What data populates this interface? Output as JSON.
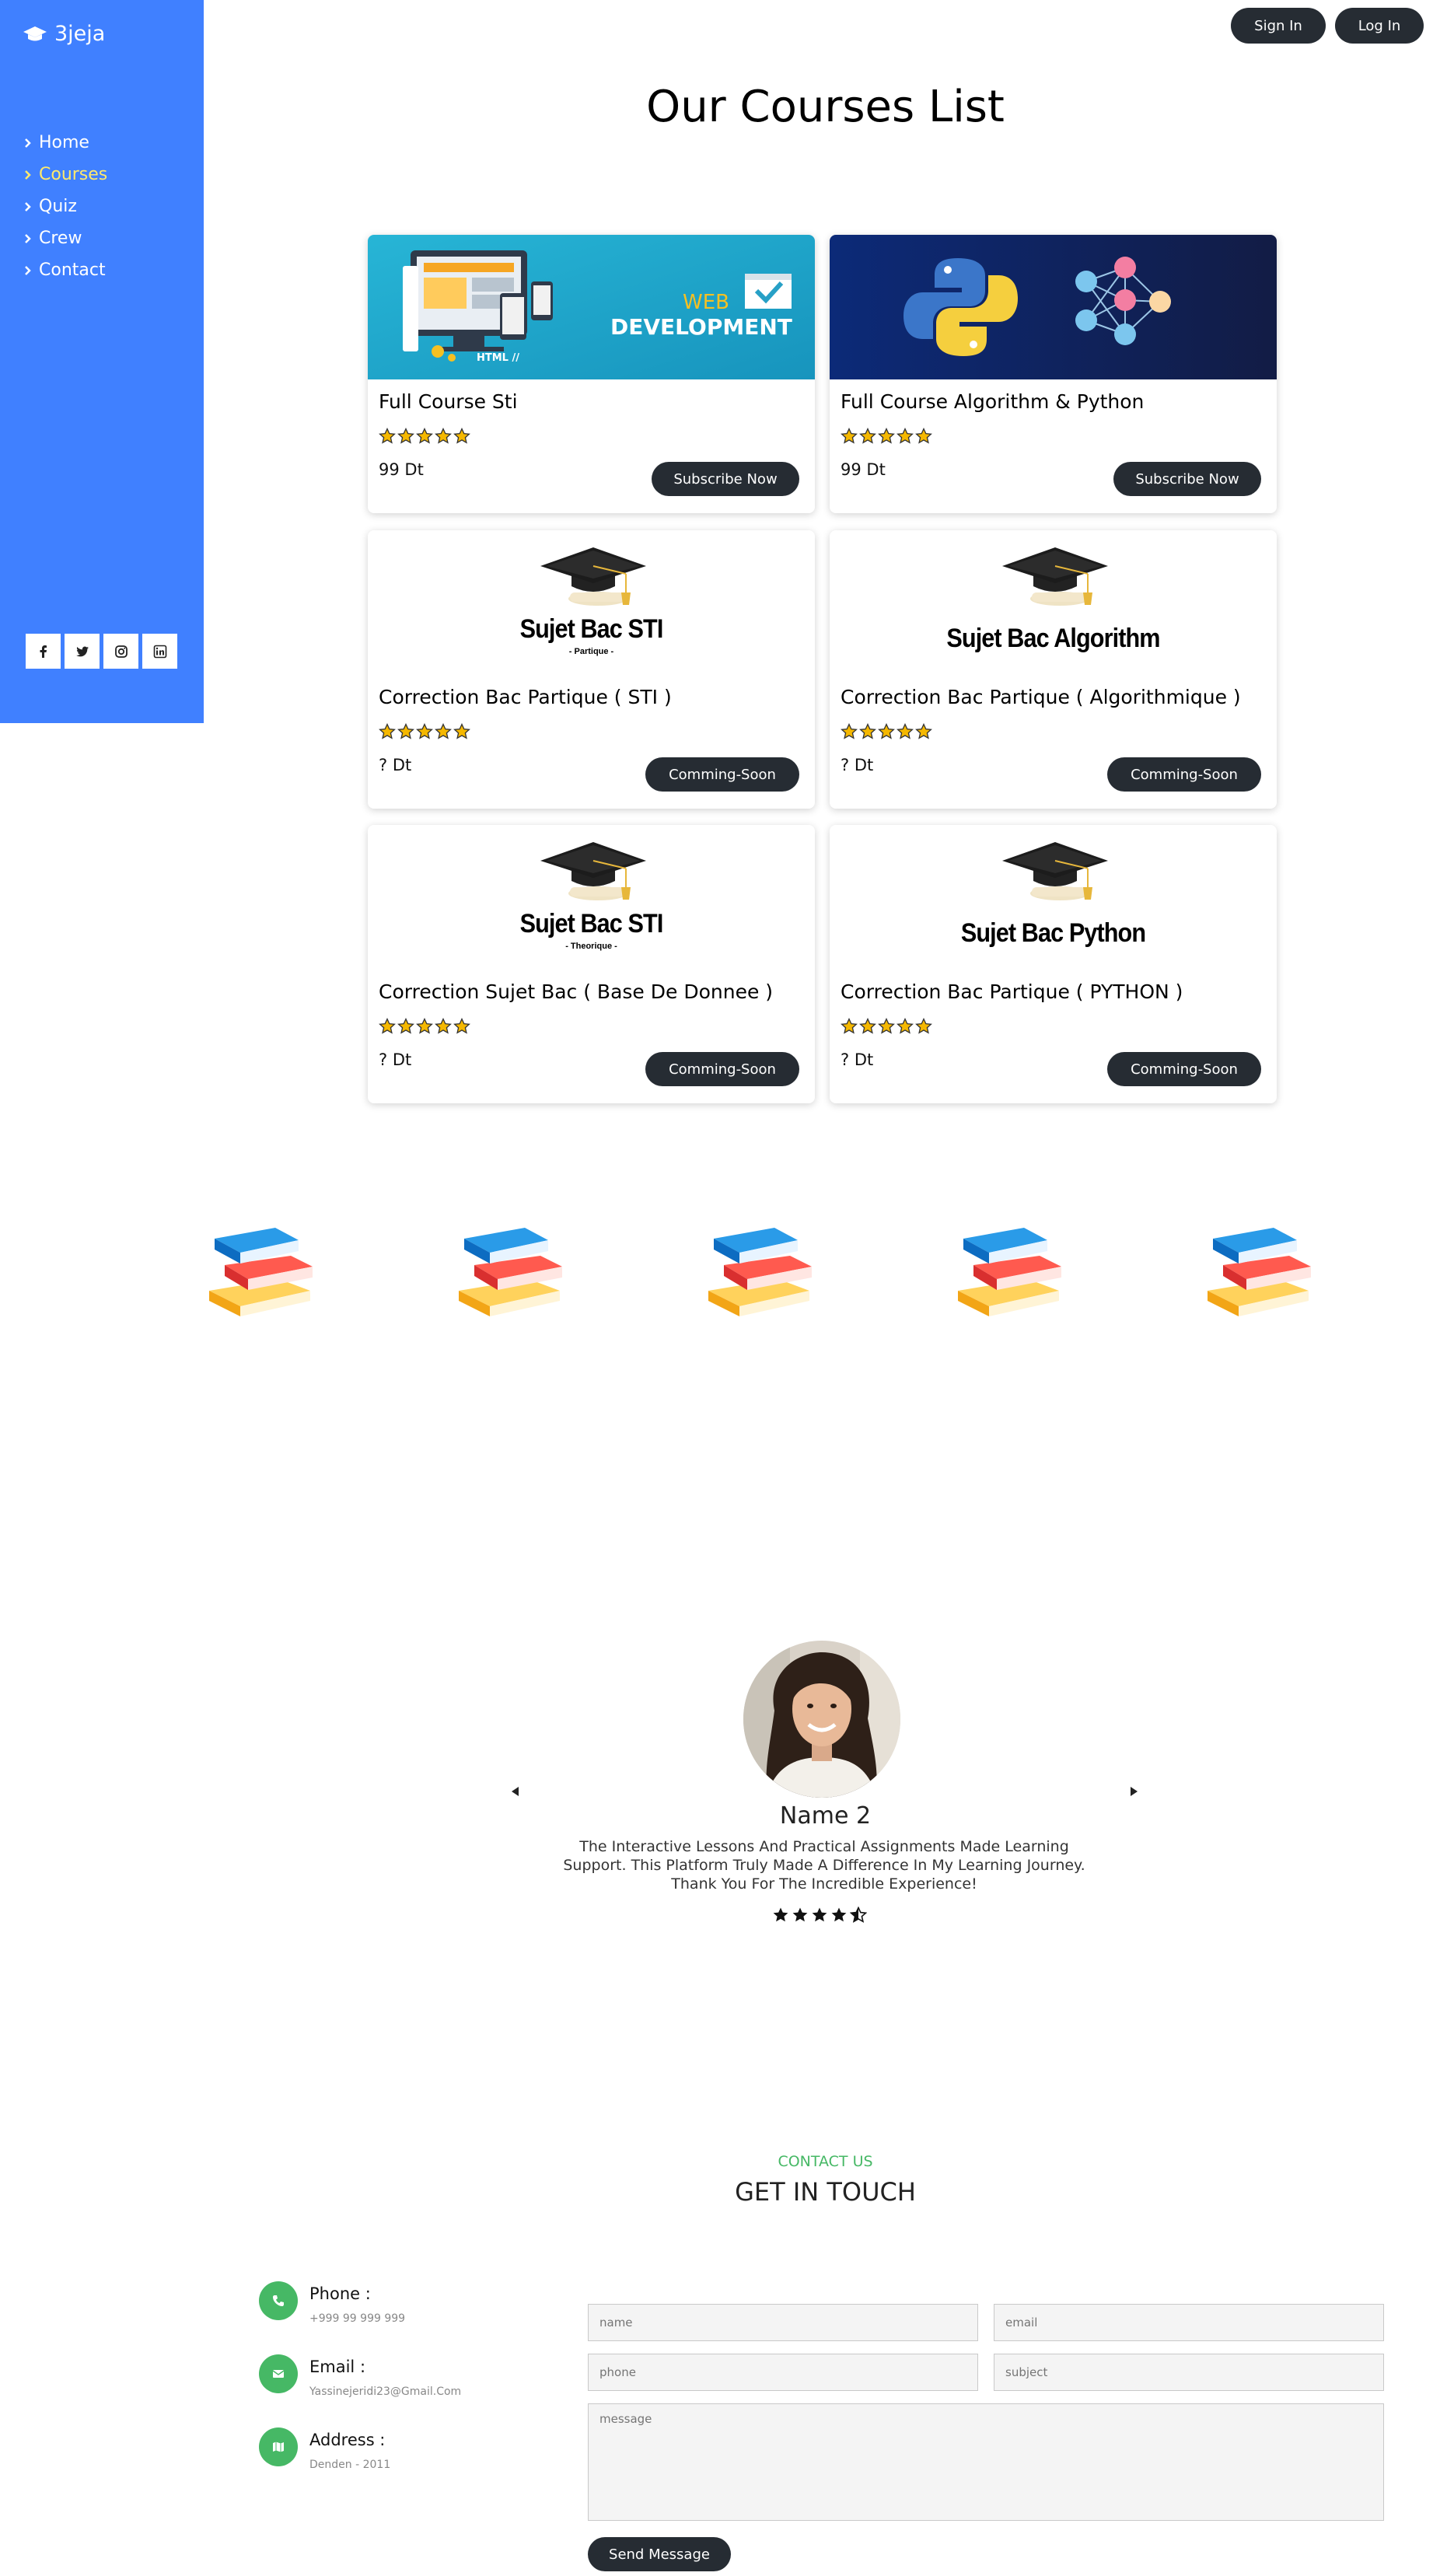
{
  "sidebar": {
    "logo": "3jeja",
    "nav": [
      {
        "label": "Home",
        "active": false
      },
      {
        "label": "Courses",
        "active": true
      },
      {
        "label": "Quiz",
        "active": false
      },
      {
        "label": "Crew",
        "active": false
      },
      {
        "label": "Contact",
        "active": false
      }
    ],
    "socials": [
      "facebook-icon",
      "twitter-icon",
      "instagram-icon",
      "linkedin-icon"
    ],
    "bg_color": "#4080ff",
    "active_color": "#ffe96b"
  },
  "header": {
    "sign_in": "Sign In",
    "log_in": "Log In"
  },
  "page_title": "Our Courses List",
  "courses": [
    {
      "title": "Full Course Sti",
      "price": "99 Dt",
      "button": "Subscribe Now",
      "image": "web-development-banner"
    },
    {
      "title": "Full Course Algorithm & Python",
      "price": "99 Dt",
      "button": "Subscribe Now",
      "image": "python-neural-network-banner"
    },
    {
      "title": "Correction Bac Partique ( STI )",
      "price": "?  Dt",
      "button": "Comming-Soon",
      "image_label": "Sujet Bac STI",
      "image_sub": "- Partique -"
    },
    {
      "title": "Correction Bac Partique ( Algorithmique )",
      "price": "?  Dt",
      "button": "Comming-Soon",
      "image_label": "Sujet Bac Algorithm",
      "image_sub": ""
    },
    {
      "title": "Correction Sujet Bac ( Base De Donnee )",
      "price": "?  Dt",
      "button": "Comming-Soon",
      "image_label": "Sujet Bac STI",
      "image_sub": "- Theorique -"
    },
    {
      "title": "Correction Bac Partique ( PYTHON )",
      "price": "?  Dt",
      "button": "Comming-Soon",
      "image_label": "Sujet Bac Python",
      "image_sub": ""
    }
  ],
  "course_rating": 5,
  "books_count": 5,
  "testimonial": {
    "name": "Name 2",
    "quote": "The Interactive Lessons And Practical Assignments Made Learning Support. This Platform Truly Made A Difference In My Learning Journey. Thank You For The Incredible Experience!",
    "rating": 4.5
  },
  "contact": {
    "label": "CONTACT US",
    "title": "GET IN TOUCH",
    "phone_label": "Phone :",
    "phone_value": "+999 99 999 999",
    "email_label": "Email :",
    "email_value": "Yassinejeridi23@Gmail.Com",
    "address_label": "Address :",
    "address_value": "Denden - 2011",
    "placeholders": {
      "name": "name",
      "email": "email",
      "phone": "phone",
      "subject": "subject",
      "message": "message"
    },
    "send": "Send Message",
    "accent": "#46b865"
  }
}
